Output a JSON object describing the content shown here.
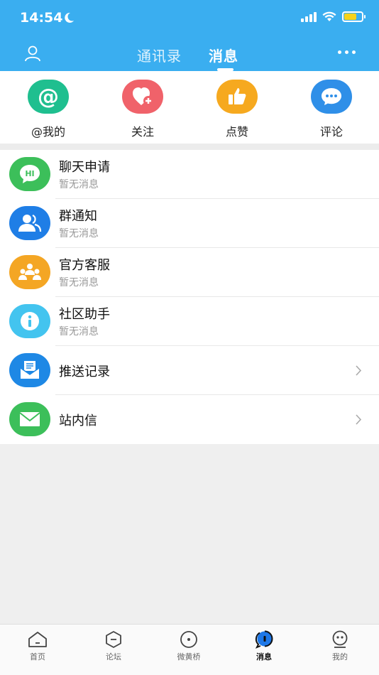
{
  "status_bar": {
    "time": "14:54"
  },
  "header": {
    "tabs": [
      {
        "label": "通讯录",
        "active": false
      },
      {
        "label": "消息",
        "active": true
      }
    ]
  },
  "quick_actions": [
    {
      "label": "@我的",
      "icon": "at-icon",
      "color": "#1fbf8f"
    },
    {
      "label": "关注",
      "icon": "heart-plus-icon",
      "color": "#f0626a"
    },
    {
      "label": "点赞",
      "icon": "thumbs-up-icon",
      "color": "#f6a91f"
    },
    {
      "label": "评论",
      "icon": "comment-icon",
      "color": "#2f8fe8"
    }
  ],
  "messages": [
    {
      "title": "聊天申请",
      "subtitle": "暂无消息",
      "icon": "hi-chat-icon",
      "color": "#3cbf5a",
      "icon_text": "HI"
    },
    {
      "title": "群通知",
      "subtitle": "暂无消息",
      "icon": "group-icon",
      "color": "#1f7ee6"
    },
    {
      "title": "官方客服",
      "subtitle": "暂无消息",
      "icon": "service-icon",
      "color": "#f4a624"
    },
    {
      "title": "社区助手",
      "subtitle": "暂无消息",
      "icon": "info-icon",
      "color": "#43c4ef"
    },
    {
      "title": "推送记录",
      "icon": "push-record-icon",
      "color": "#1e88e5"
    },
    {
      "title": "站内信",
      "icon": "mail-icon",
      "color": "#3cbf5a"
    }
  ],
  "bottom_nav": [
    {
      "label": "首页",
      "icon": "home-icon",
      "active": false
    },
    {
      "label": "论坛",
      "icon": "forum-icon",
      "active": false
    },
    {
      "label": "微黄桥",
      "icon": "circle-dot-icon",
      "active": false
    },
    {
      "label": "消息",
      "icon": "message-icon",
      "active": true
    },
    {
      "label": "我的",
      "icon": "profile-icon",
      "active": false
    }
  ]
}
